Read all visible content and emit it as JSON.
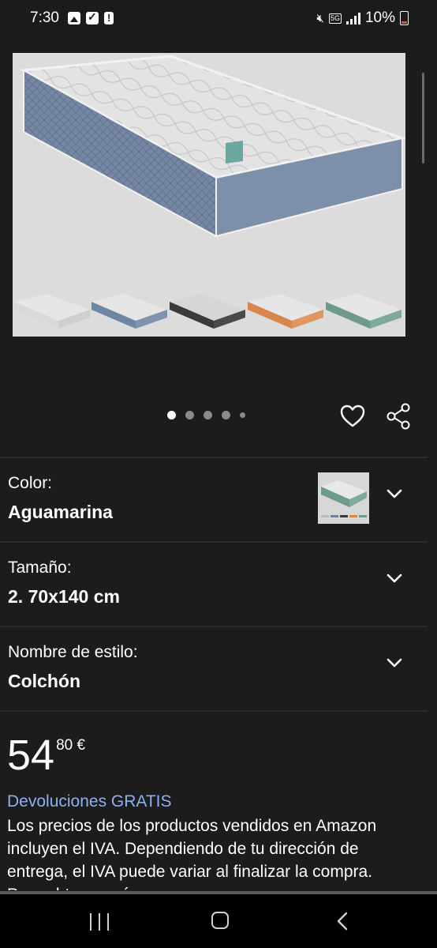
{
  "status_bar": {
    "time": "7:30",
    "network": "5G",
    "battery": "10%",
    "icons": [
      "gallery-icon",
      "checkbox-icon",
      "alert-icon",
      "mute-icon",
      "signal-icon",
      "battery-icon"
    ]
  },
  "carousel": {
    "total_images": 5,
    "active_index": 0
  },
  "variants": [
    {
      "label": "Color:",
      "value": "Aguamarina"
    },
    {
      "label": "Tamaño:",
      "value": "2. 70x140 cm"
    },
    {
      "label": "Nombre de estilo:",
      "value": "Colchón"
    }
  ],
  "price": {
    "whole": "54",
    "fraction_currency": "80 €"
  },
  "returns_link": "Devoluciones GRATIS",
  "description": "Los precios de los productos vendidos en Amazon incluyen el IVA. Dependiendo de tu dirección de entrega, el IVA puede variar al finalizar la compra. Para obtener más",
  "colors": {
    "background": "#1c1c1c",
    "link": "#8db0f5",
    "mattress_swatches": [
      "#d9d9d9",
      "#6f86a3",
      "#3a3a3a",
      "#d7864d",
      "#6e9a8c"
    ]
  }
}
